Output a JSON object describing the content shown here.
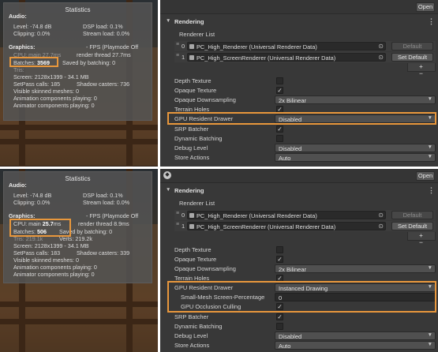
{
  "top": {
    "stats": {
      "title": "Statistics",
      "audio_header": "Audio:",
      "audio_level": "Level: -74.8 dB",
      "audio_clipping": "Clipping: 0.0%",
      "dsp_load": "DSP load: 0.1%",
      "stream_load": "Stream load: 0.0%",
      "graphics_header": "Graphics:",
      "fps": "- FPS (Playmode Off",
      "cpu_partial": "CPU: main 27.7ms",
      "render_thread": "render thread 27.7ms",
      "batches_label": "Batches:",
      "batches_value": "3569",
      "saved_batching": "Saved by batching: 0",
      "tris": "Tris:",
      "screen": "Screen: 2128x1399 - 34.1 MB",
      "setpass": "SetPass calls: 185",
      "shadow_casters": "Shadow casters: 736",
      "visible_skinned": "Visible skinned meshes: 0",
      "animation_components": "Animation components playing: 0",
      "animator_components": "Animator components playing: 0"
    },
    "inspector": {
      "open_label": "Open",
      "section_title": "Rendering",
      "renderer_list_label": "Renderer List",
      "renderers": [
        {
          "index": "0",
          "name": "PC_High_Renderer (Universal Renderer Data)",
          "button": "Default"
        },
        {
          "index": "1",
          "name": "PC_High_ScreenRenderer (Universal Renderer Data)",
          "button": "Set Default"
        }
      ],
      "plus_minus": "+ −",
      "rows": [
        {
          "label": "Depth Texture",
          "type": "check",
          "value": ""
        },
        {
          "label": "Opaque Texture",
          "type": "check",
          "value": "✓"
        },
        {
          "label": "Opaque Downsampling",
          "type": "dropdown",
          "value": "2x Bilinear"
        },
        {
          "label": "Terrain Holes",
          "type": "check",
          "value": "✓"
        },
        {
          "label": "GPU Resident Drawer",
          "type": "dropdown",
          "value": "Disabled"
        },
        {
          "label": "SRP Batcher",
          "type": "check",
          "value": "✓"
        },
        {
          "label": "Dynamic Batching",
          "type": "check",
          "value": ""
        },
        {
          "label": "Debug Level",
          "type": "dropdown",
          "value": "Disabled"
        },
        {
          "label": "Store Actions",
          "type": "dropdown",
          "value": "Auto"
        }
      ]
    }
  },
  "bottom": {
    "stats": {
      "title": "Statistics",
      "audio_header": "Audio:",
      "audio_level": "Level: -74.8 dB",
      "audio_clipping": "Clipping: 0.0%",
      "dsp_load": "DSP load: 0.1%",
      "stream_load": "Stream load: 0.0%",
      "graphics_header": "Graphics:",
      "fps": "- FPS (Playmode Off",
      "cpu_label": "CPU: main",
      "cpu_value": "25.7",
      "cpu_unit": "ms",
      "render_thread": "render thread 8.9ms",
      "batches_label": "Batches:",
      "batches_value": "506",
      "saved_batching": "Saved by batching: 0",
      "tris": "Tris: 219.1k",
      "verts": "Verts: 219.2k",
      "screen": "Screen: 2128x1399 - 34.1 MB",
      "setpass": "SetPass calls: 183",
      "shadow_casters": "Shadow casters: 339",
      "visible_skinned": "Visible skinned meshes: 0",
      "animation_components": "Animation components playing: 0",
      "animator_components": "Animator components playing: 0"
    },
    "inspector": {
      "open_label": "Open",
      "section_title": "Rendering",
      "renderer_list_label": "Renderer List",
      "renderers": [
        {
          "index": "0",
          "name": "PC_High_Renderer (Universal Renderer Data)",
          "button": "Default"
        },
        {
          "index": "1",
          "name": "PC_High_ScreenRenderer (Universal Renderer Data)",
          "button": "Set Default"
        }
      ],
      "plus_minus": "+ −",
      "rows": [
        {
          "label": "Depth Texture",
          "type": "check",
          "value": ""
        },
        {
          "label": "Opaque Texture",
          "type": "check",
          "value": "✓"
        },
        {
          "label": "Opaque Downsampling",
          "type": "dropdown",
          "value": "2x Bilinear"
        },
        {
          "label": "Terrain Holes",
          "type": "check",
          "value": "✓"
        },
        {
          "label": "GPU Resident Drawer",
          "type": "dropdown",
          "value": "Instanced Drawing"
        },
        {
          "label": "Small-Mesh Screen-Percentage",
          "type": "number",
          "value": "0"
        },
        {
          "label": "GPU Occlusion Culling",
          "type": "check",
          "value": "✓"
        },
        {
          "label": "SRP Batcher",
          "type": "check",
          "value": "✓"
        },
        {
          "label": "Dynamic Batching",
          "type": "check",
          "value": ""
        },
        {
          "label": "Debug Level",
          "type": "dropdown",
          "value": "Disabled"
        },
        {
          "label": "Store Actions",
          "type": "dropdown",
          "value": "Auto"
        }
      ]
    }
  },
  "colors": {
    "highlight": "#e8973c",
    "panel_bg": "#383838",
    "stats_bg": "#545454"
  },
  "icons": [
    "unity-icon",
    "kebab-menu-icon",
    "foldout-arrow-icon",
    "object-picker-icon",
    "drag-handle-icon",
    "dropdown-caret-icon",
    "checkmark-icon"
  ]
}
